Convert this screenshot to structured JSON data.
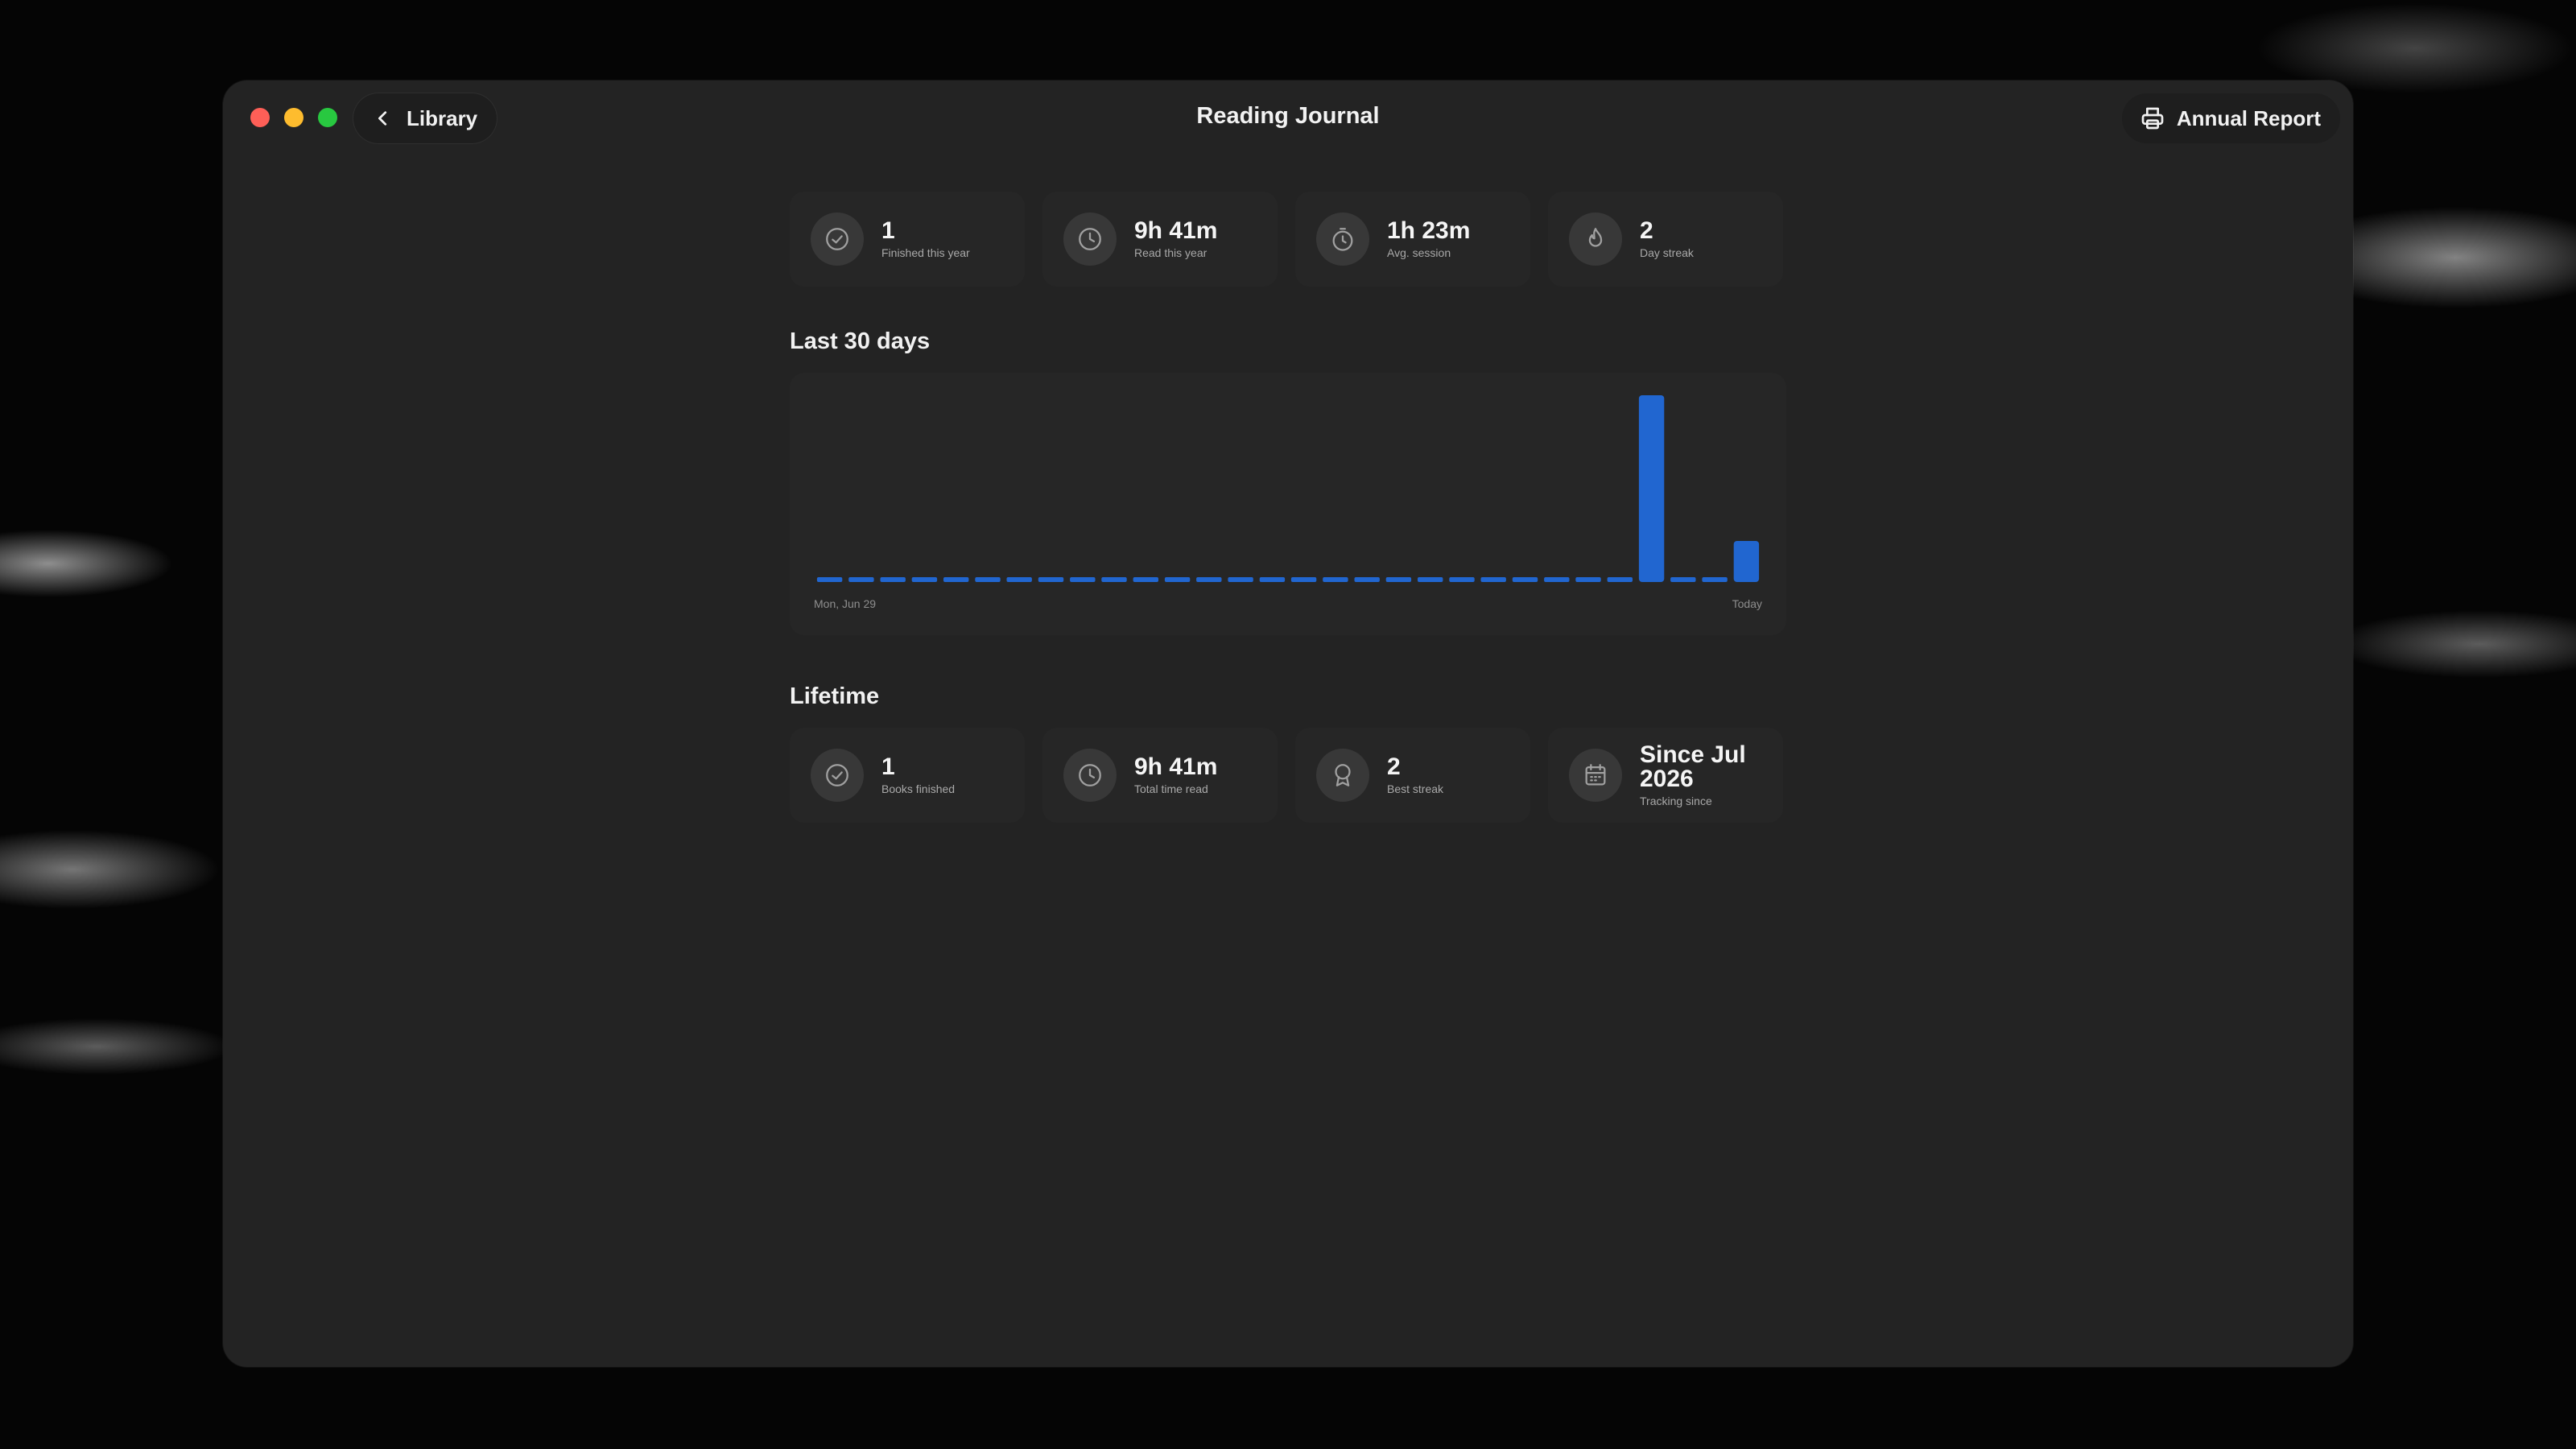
{
  "window": {
    "title": "Reading Journal",
    "back_label": "Library",
    "report_label": "Annual Report"
  },
  "year_stats": [
    {
      "value": "1",
      "label": "Finished this year",
      "icon": "check-circle-icon"
    },
    {
      "value": "9h 41m",
      "label": "Read this year",
      "icon": "clock-icon"
    },
    {
      "value": "1h 23m",
      "label": "Avg. session",
      "icon": "stopwatch-icon"
    },
    {
      "value": "2",
      "label": "Day streak",
      "icon": "flame-icon"
    }
  ],
  "chart_section": {
    "title": "Last 30 days"
  },
  "chart_data": {
    "type": "bar",
    "start_label": "Mon, Jun 29",
    "end_label": "Today",
    "values": [
      0,
      0,
      0,
      0,
      0,
      0,
      0,
      0,
      0,
      0,
      0,
      0,
      0,
      0,
      0,
      0,
      0,
      0,
      0,
      0,
      0,
      0,
      0,
      0,
      0,
      0,
      1.0,
      0,
      0,
      0.22
    ],
    "color": "#2166d0"
  },
  "lifetime_section": {
    "title": "Lifetime"
  },
  "lifetime_stats": [
    {
      "value": "1",
      "label": "Books finished",
      "icon": "check-circle-icon"
    },
    {
      "value": "9h 41m",
      "label": "Total time read",
      "icon": "clock-icon"
    },
    {
      "value": "2",
      "label": "Best streak",
      "icon": "award-icon"
    },
    {
      "value": "Since Jul 2026",
      "label": "Tracking since",
      "icon": "calendar-icon"
    }
  ]
}
